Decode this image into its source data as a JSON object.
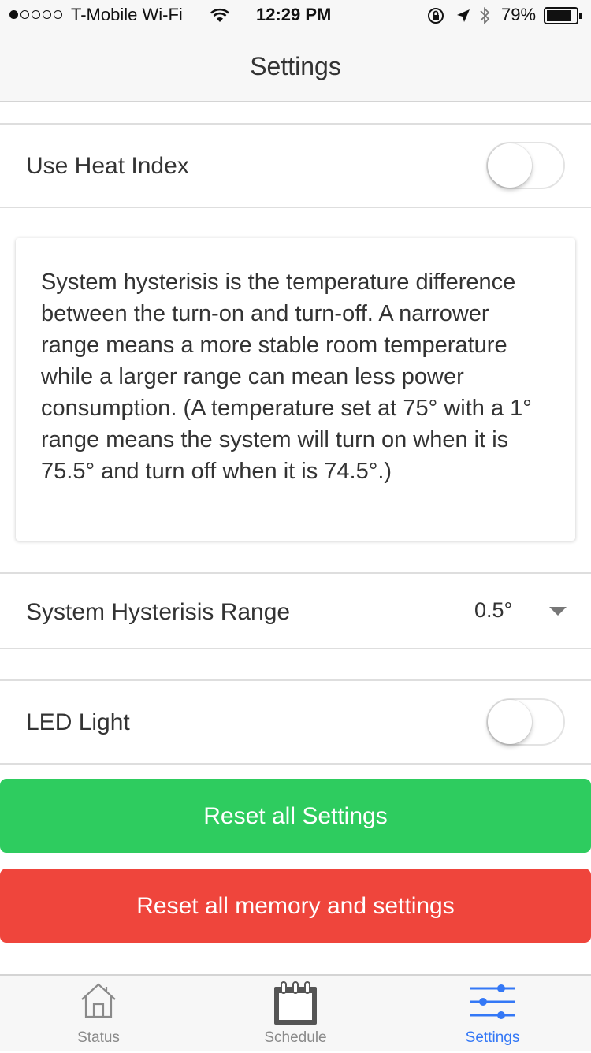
{
  "status_bar": {
    "carrier": "T-Mobile Wi-Fi",
    "time": "12:29 PM",
    "battery": "79%",
    "signal_dots_filled": 1,
    "signal_dots_total": 5
  },
  "nav": {
    "title": "Settings"
  },
  "heat_index": {
    "label": "Use Heat Index",
    "enabled": false
  },
  "info_card": {
    "text": "System hysterisis is the temperature difference between the turn-on and turn-off. A narrower range means a more stable room temperature while a larger range can mean less power consumption. (A temperature set at 75° with a 1° range means the system will turn on when it is 75.5° and turn off when it is 74.5°.)"
  },
  "hysteresis": {
    "label": "System Hysterisis Range",
    "value": "0.5°"
  },
  "led_light": {
    "label": "LED Light",
    "enabled": false
  },
  "buttons": {
    "reset_settings": "Reset all Settings",
    "reset_memory": "Reset all memory and settings"
  },
  "colors": {
    "green": "#2ecc5f",
    "red": "#ef453c",
    "active_tab": "#3478f6",
    "inactive_tab": "#8a8a8a"
  },
  "tabs": [
    {
      "label": "Status",
      "icon": "house-icon",
      "active": false
    },
    {
      "label": "Schedule",
      "icon": "calendar-icon",
      "active": false
    },
    {
      "label": "Settings",
      "icon": "sliders-icon",
      "active": true
    }
  ]
}
